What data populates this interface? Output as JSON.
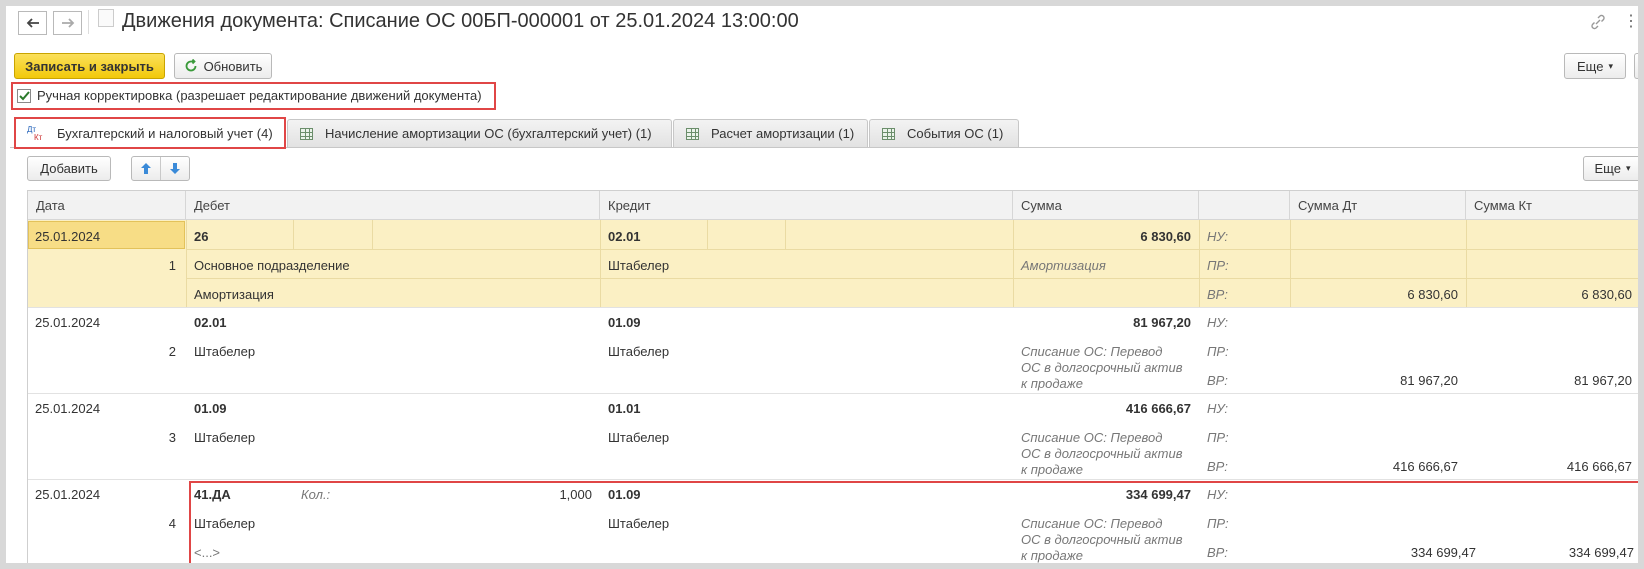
{
  "window": {
    "title": "Движения документа: Списание ОС 00БП-000001 от 25.01.2024 13:00:00"
  },
  "toolbar": {
    "save_close": "Записать и закрыть",
    "refresh": "Обновить",
    "more": "Еще",
    "more_arrow": "▾"
  },
  "manual_edit": {
    "checked": true,
    "label": "Ручная корректировка (разрешает редактирование движений документа)"
  },
  "tabs": [
    {
      "label": "Бухгалтерский и налоговый учет (4)",
      "icon": "dt-kt-icon"
    },
    {
      "label": "Начисление амортизации ОС (бухгалтерский учет) (1)",
      "icon": "table-icon"
    },
    {
      "label": "Расчет амортизации (1)",
      "icon": "table-icon"
    },
    {
      "label": "События ОС (1)",
      "icon": "table-icon"
    }
  ],
  "tab_icon_text": {
    "dt": "Дт",
    "kt": "Кт"
  },
  "table_toolbar": {
    "add": "Добавить",
    "more": "Еще"
  },
  "columns": {
    "date": "Дата",
    "debit": "Дебет",
    "credit": "Кредит",
    "sum": "Сумма",
    "sum_dt": "Сумма Дт",
    "sum_kt": "Сумма Кт"
  },
  "rows": [
    {
      "date": "25.01.2024",
      "num": "1",
      "debit_account": "26",
      "debit_sub1": "Основное подразделение",
      "debit_sub2": "Амортизация",
      "credit_account": "02.01",
      "credit_sub1": "Штабелер",
      "sum": "6 830,60",
      "content": "Амортизация",
      "nu": "НУ:",
      "pr": "ПР:",
      "vr": "ВР:",
      "sum_dt": "6 830,60",
      "sum_kt": "6 830,60"
    },
    {
      "date": "25.01.2024",
      "num": "2",
      "debit_account": "02.01",
      "debit_sub1": "Штабелер",
      "credit_account": "01.09",
      "credit_sub1": "Штабелер",
      "sum": "81 967,20",
      "content": [
        "Списание ОС: Перевод",
        "ОС в долгосрочный актив",
        "к продаже"
      ],
      "nu": "НУ:",
      "pr": "ПР:",
      "vr": "ВР:",
      "sum_dt": "81 967,20",
      "sum_kt": "81 967,20"
    },
    {
      "date": "25.01.2024",
      "num": "3",
      "debit_account": "01.09",
      "debit_sub1": "Штабелер",
      "credit_account": "01.01",
      "credit_sub1": "Штабелер",
      "sum": "416 666,67",
      "content": [
        "Списание ОС: Перевод",
        "ОС в долгосрочный актив",
        "к продаже"
      ],
      "nu": "НУ:",
      "pr": "ПР:",
      "vr": "ВР:",
      "sum_dt": "416 666,67",
      "sum_kt": "416 666,67"
    },
    {
      "date": "25.01.2024",
      "num": "4",
      "debit_account": "41.ДА",
      "qty_label": "Кол.:",
      "qty": "1,000",
      "debit_sub1": "Штабелер",
      "debit_sub2": "<...>",
      "credit_account": "01.09",
      "credit_sub1": "Штабелер",
      "sum": "334 699,47",
      "content": [
        "Списание ОС: Перевод",
        "ОС в долгосрочный актив",
        "к продаже"
      ],
      "nu": "НУ:",
      "pr": "ПР:",
      "vr": "ВР:",
      "sum_dt": "334 699,47",
      "sum_kt": "334 699,47"
    }
  ],
  "colors": {
    "accent_yellow": "#f9d71c",
    "selected_row": "#fbf0c4",
    "highlight_border": "#e04646"
  }
}
